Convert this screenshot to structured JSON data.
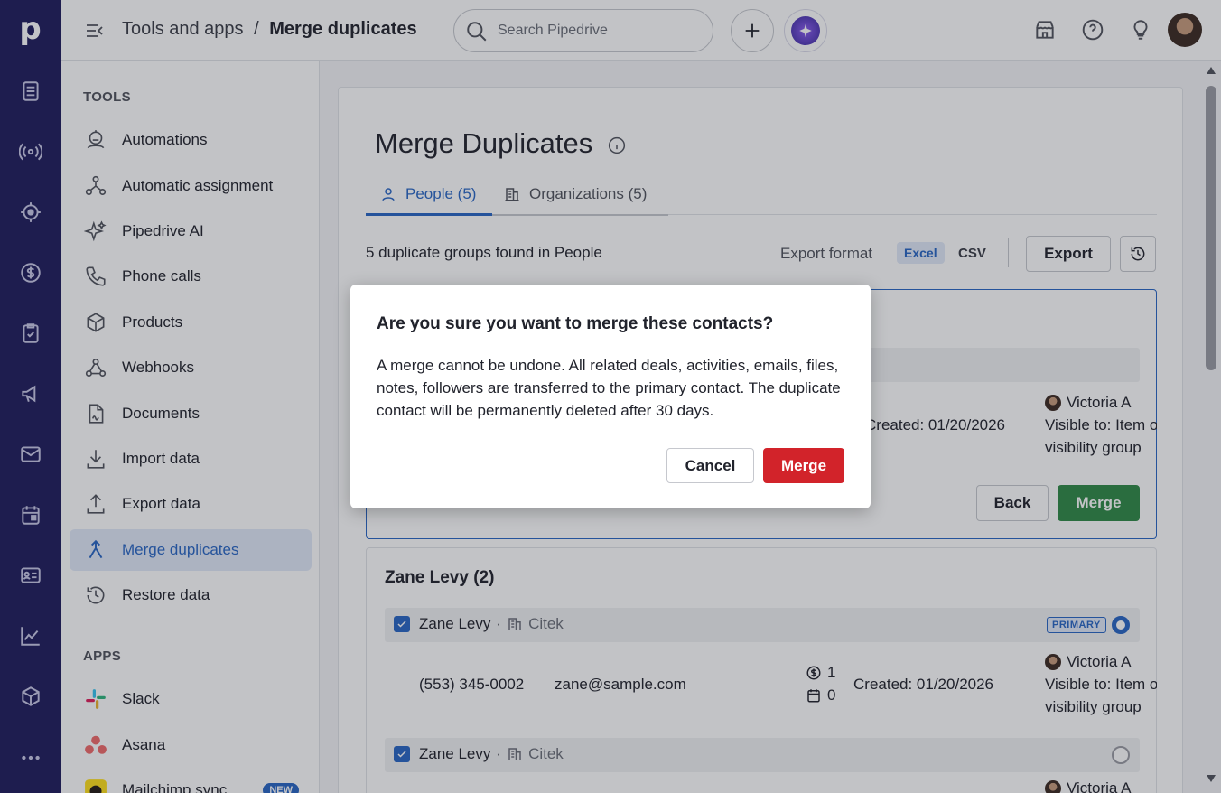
{
  "rail": {
    "logo": "p"
  },
  "header": {
    "breadcrumb_parent": "Tools and apps",
    "breadcrumb_sep": "/",
    "breadcrumb_current": "Merge duplicates",
    "search_placeholder": "Search Pipedrive"
  },
  "sidebar": {
    "tools_heading": "TOOLS",
    "tools": [
      {
        "label": "Automations"
      },
      {
        "label": "Automatic assignment"
      },
      {
        "label": "Pipedrive AI"
      },
      {
        "label": "Phone calls"
      },
      {
        "label": "Products"
      },
      {
        "label": "Webhooks"
      },
      {
        "label": "Documents"
      },
      {
        "label": "Import data"
      },
      {
        "label": "Export data"
      },
      {
        "label": "Merge duplicates"
      },
      {
        "label": "Restore data"
      }
    ],
    "apps_heading": "APPS",
    "apps": [
      {
        "label": "Slack"
      },
      {
        "label": "Asana"
      },
      {
        "label": "Mailchimp sync",
        "badge": "NEW"
      }
    ]
  },
  "main": {
    "title": "Merge Duplicates",
    "tabs": [
      {
        "label": "People (5)"
      },
      {
        "label": "Organizations (5)"
      }
    ],
    "summary": "5 duplicate groups found in People",
    "export_format_label": "Export format",
    "format_excel": "Excel",
    "format_csv": "CSV",
    "export_button": "Export",
    "group1": {
      "created": "Created: 01/20/2026",
      "owner": "Victoria A",
      "visible_line1": "Visible to: Item o",
      "visible_line2": "visibility group",
      "back_button": "Back",
      "merge_button": "Merge"
    },
    "group2": {
      "title": "Zane Levy (2)",
      "row1": {
        "name": "Zane Levy",
        "dot": "·",
        "org": "Citek",
        "badge": "PRIMARY",
        "phone": "(553) 345-0002",
        "email": "zane@sample.com",
        "deals": "1",
        "activities": "0",
        "created": "Created: 01/20/2026",
        "owner": "Victoria A",
        "visible_line1": "Visible to: Item o",
        "visible_line2": "visibility group"
      },
      "row2": {
        "name": "Zane Levy",
        "dot": "·",
        "org": "Citek",
        "owner": "Victoria A"
      }
    }
  },
  "modal": {
    "title": "Are you sure you want to merge these contacts?",
    "body": "A merge cannot be undone. All related deals, activities, emails, files, notes, followers are transferred to the primary contact. The duplicate contact will be permanently deleted after 30 days.",
    "cancel_button": "Cancel",
    "merge_button": "Merge"
  },
  "colors": {
    "rail": "#1f1c5c",
    "accent": "#2966c4",
    "merge_green": "#2f8a46",
    "danger": "#d2232a"
  }
}
